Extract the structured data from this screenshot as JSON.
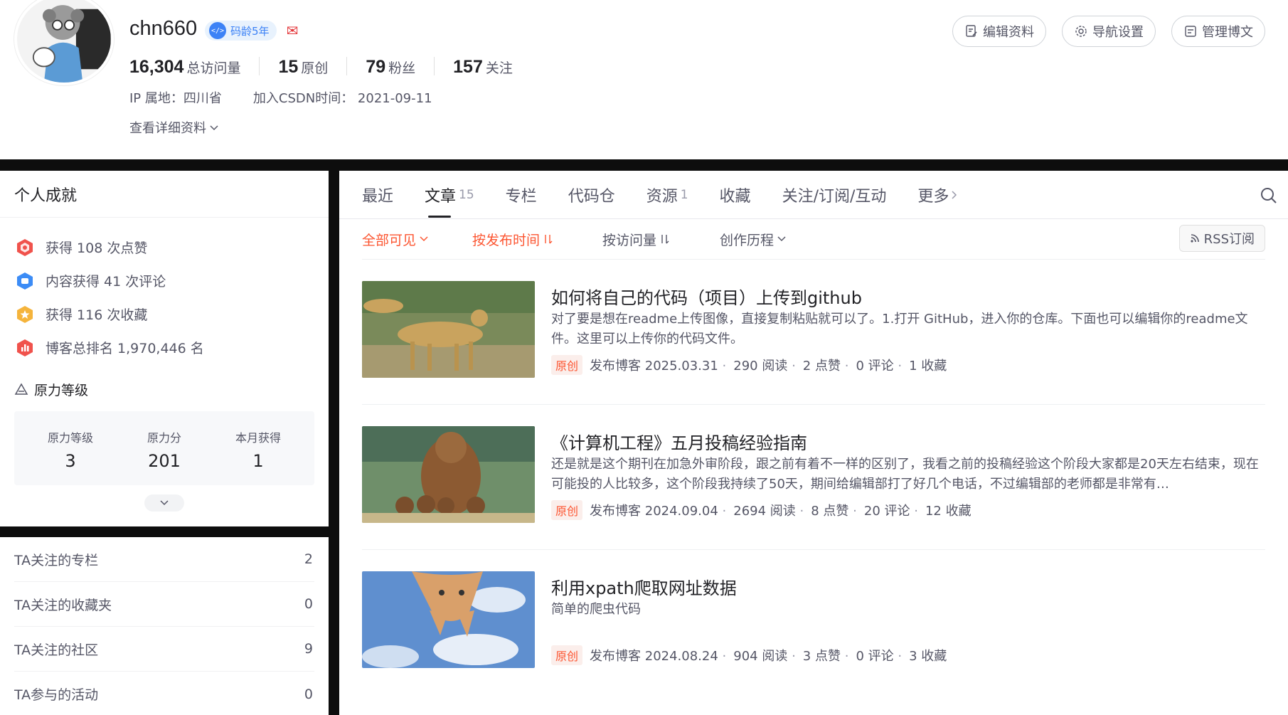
{
  "profile": {
    "username": "chn660",
    "code_age": "码龄5年",
    "stats": [
      {
        "num": "16,304",
        "label": "总访问量"
      },
      {
        "num": "15",
        "label": "原创"
      },
      {
        "num": "79",
        "label": "粉丝"
      },
      {
        "num": "157",
        "label": "关注"
      }
    ],
    "ip": "IP 属地：四川省",
    "joined": "加入CSDN时间：  2021-09-11",
    "detail_link": "查看详细资料",
    "buttons": {
      "edit": "编辑资料",
      "nav": "导航设置",
      "manage": "管理博文"
    }
  },
  "achievements": {
    "title": "个人成就",
    "items": [
      {
        "text": "获得 108 次点赞",
        "color": "#f0524c"
      },
      {
        "text": "内容获得 41 次评论",
        "color": "#3c8cf6"
      },
      {
        "text": "获得 116 次收藏",
        "color": "#f5b43c"
      },
      {
        "text": "博客总排名 1,970,446 名",
        "color": "#f0524c"
      }
    ],
    "level_title": "原力等级",
    "level": [
      {
        "key": "原力等级",
        "value": "3"
      },
      {
        "key": "原力分",
        "value": "201"
      },
      {
        "key": "本月获得",
        "value": "1"
      }
    ]
  },
  "follows": [
    {
      "label": "TA关注的专栏",
      "count": "2"
    },
    {
      "label": "TA关注的收藏夹",
      "count": "0"
    },
    {
      "label": "TA关注的社区",
      "count": "9"
    },
    {
      "label": "TA参与的活动",
      "count": "0"
    }
  ],
  "tabs": [
    {
      "label": "最近",
      "count": ""
    },
    {
      "label": "文章",
      "count": "15"
    },
    {
      "label": "专栏",
      "count": ""
    },
    {
      "label": "代码仓",
      "count": ""
    },
    {
      "label": "资源",
      "count": "1"
    },
    {
      "label": "收藏",
      "count": ""
    },
    {
      "label": "关注/订阅/互动",
      "count": ""
    },
    {
      "label": "更多",
      "count": ""
    }
  ],
  "filters": {
    "visibility": "全部可见",
    "by_time": "按发布时间",
    "by_views": "按访问量",
    "history": "创作历程",
    "rss": "RSS订阅"
  },
  "articles": [
    {
      "title": "如何将自己的代码（项目）上传到github",
      "desc": "对了要是想在readme上传图像，直接复制粘贴就可以了。1.打开 GitHub，进入你的仓库。下面也可以编辑你的readme文件。这里可以上传你的代码文件。",
      "tag": "原创",
      "date": "发布博客 2025.03.31",
      "reads": "290 阅读",
      "likes": "2 点赞",
      "comments": "0 评论",
      "favs": "1 收藏"
    },
    {
      "title": "《计算机工程》五月投稿经验指南",
      "desc": "还是就是这个期刊在加急外审阶段，跟之前有着不一样的区别了，我看之前的投稿经验这个阶段大家都是20天左右结束，现在可能投的人比较多，这个阶段我持续了50天，期间给编辑部打了好几个电话，不过编辑部的老师都是非常有…",
      "tag": "原创",
      "date": "发布博客 2024.09.04",
      "reads": "2694 阅读",
      "likes": "8 点赞",
      "comments": "20 评论",
      "favs": "12 收藏"
    },
    {
      "title": "利用xpath爬取网址数据",
      "desc": "简单的爬虫代码",
      "tag": "原创",
      "date": "发布博客 2024.08.24",
      "reads": "904 阅读",
      "likes": "3 点赞",
      "comments": "0 评论",
      "favs": "3 收藏"
    }
  ]
}
